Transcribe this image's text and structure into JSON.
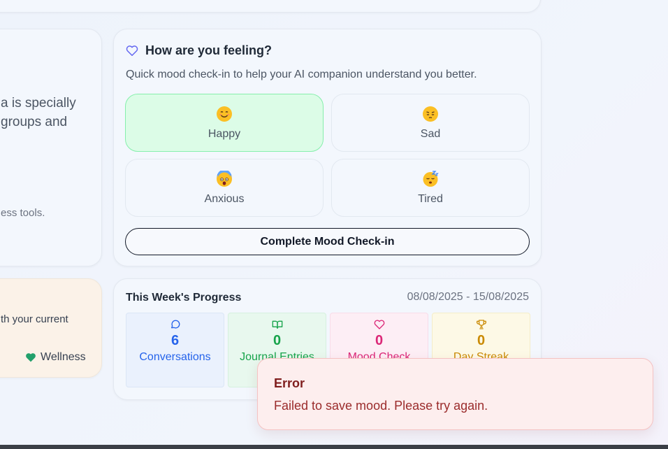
{
  "left_panel": {
    "text_line_1": "a is specially",
    "text_line_2": "groups and",
    "text_line_3": "ess tools.",
    "card2_text": "th your current",
    "wellness_label": "Wellness"
  },
  "mood_checkin": {
    "title": "How are you feeling?",
    "subtitle": "Quick mood check-in to help your AI companion understand you better.",
    "options": [
      {
        "label": "Happy",
        "icon": "smiling-face-icon",
        "selected": true
      },
      {
        "label": "Sad",
        "icon": "pensive-face-icon",
        "selected": false
      },
      {
        "label": "Anxious",
        "icon": "fearful-face-icon",
        "selected": false
      },
      {
        "label": "Tired",
        "icon": "sleeping-face-icon",
        "selected": false
      }
    ],
    "complete_label": "Complete Mood Check-in"
  },
  "progress": {
    "title": "This Week's Progress",
    "date_range": "08/08/2025 - 15/08/2025",
    "stats": [
      {
        "value": "6",
        "label": "Conversations",
        "icon": "chat-bubble-icon",
        "color": "#2563eb"
      },
      {
        "value": "0",
        "label": "Journal Entries",
        "icon": "book-open-icon",
        "color": "#16a34a"
      },
      {
        "value": "0",
        "label": "Mood Check",
        "icon": "heart-icon",
        "color": "#db2777"
      },
      {
        "value": "0",
        "label": "Day Streak",
        "icon": "trophy-icon",
        "color": "#ca8a04"
      }
    ]
  },
  "toast": {
    "title": "Error",
    "message": "Failed to save mood. Please try again."
  },
  "colors": {
    "selected_bg": "#dcfce7",
    "selected_border": "#86efac",
    "error_bg": "#fdeeee",
    "error_text": "#7f1d1d"
  }
}
